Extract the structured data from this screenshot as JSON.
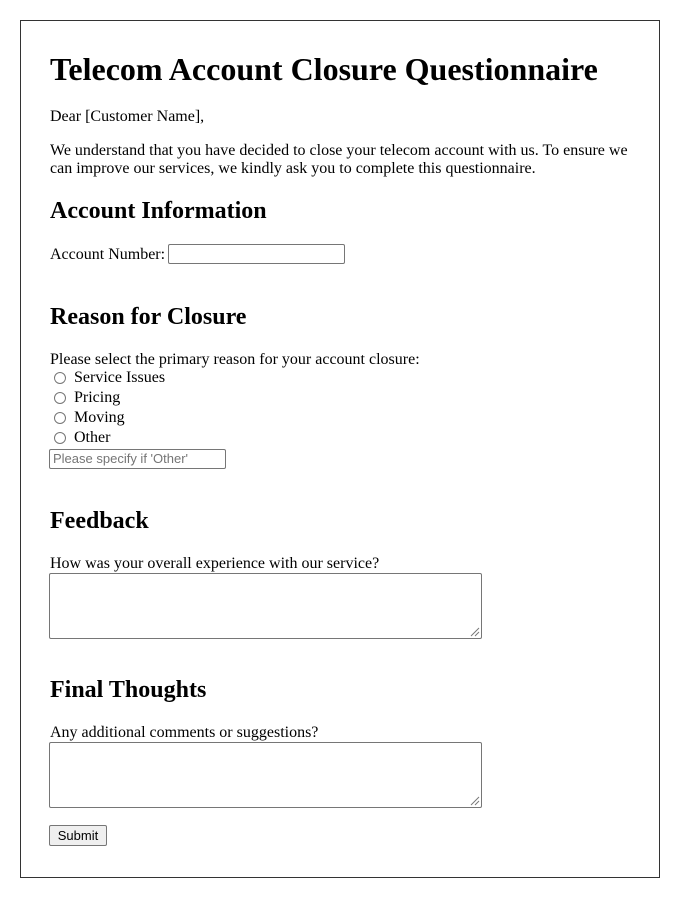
{
  "title": "Telecom Account Closure Questionnaire",
  "greeting": "Dear [Customer Name],",
  "intro_line1": "We understand that you have decided to close your telecom account with us. To ensure we",
  "intro_line2": "can improve our services, we kindly ask you to complete this questionnaire.",
  "account_section": {
    "heading": "Account Information",
    "account_number_label": "Account Number:",
    "account_number_value": ""
  },
  "reason_section": {
    "heading": "Reason for Closure",
    "prompt": "Please select the primary reason for your account closure:",
    "options": [
      {
        "label": "Service Issues",
        "checked": false
      },
      {
        "label": "Pricing",
        "checked": false
      },
      {
        "label": "Moving",
        "checked": false
      },
      {
        "label": "Other",
        "checked": false
      }
    ],
    "other_placeholder": "Please specify if 'Other'",
    "other_value": ""
  },
  "feedback_section": {
    "heading": "Feedback",
    "prompt": "How was your overall experience with our service?",
    "value": ""
  },
  "final_section": {
    "heading": "Final Thoughts",
    "prompt": "Any additional comments or suggestions?",
    "value": ""
  },
  "submit_label": "Submit"
}
